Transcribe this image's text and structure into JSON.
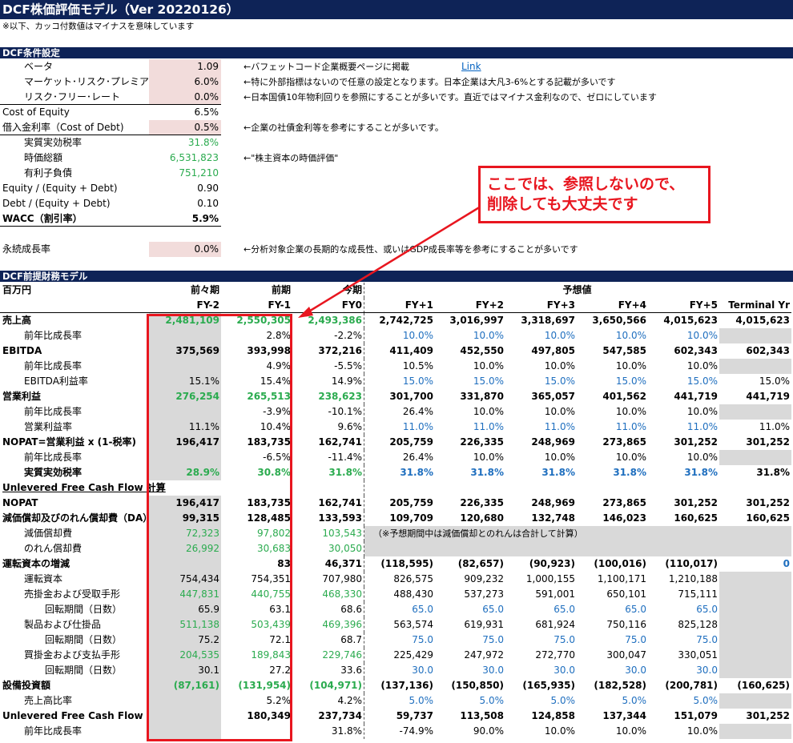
{
  "title": "DCF株価評価モデル（Ver 20220126）",
  "note": "※以下、カッコ付数値はマイナスを意味しています",
  "conditions": {
    "header": "DCF条件設定",
    "link_label": "Link",
    "rows": [
      {
        "label": "ベータ",
        "value": "1.09",
        "note": "←バフェットコード企業概要ページに掲載"
      },
      {
        "label": "マーケット･リスク･プレミアム",
        "value": "6.0%",
        "note": "←特に外部指標はないので任意の設定となります。日本企業は大凡3-6%とする記載が多いです"
      },
      {
        "label": "リスク･フリー･レート",
        "value": "0.0%",
        "note": "←日本国債10年物利回りを参照にすることが多いです。直近ではマイナス金利なので、ゼロにしています"
      },
      {
        "label": "Cost of Equity",
        "value": "6.5%",
        "note": ""
      },
      {
        "label": "借入金利率（Cost of Debt)",
        "value": "0.5%",
        "note": "←企業の社債金利等を参考にすることが多いです。"
      },
      {
        "label": "実質実効税率",
        "value": "31.8%",
        "note": ""
      },
      {
        "label": "時価総額",
        "value": "6,531,823",
        "note": "←\"株主資本の時価評価\""
      },
      {
        "label": "有利子負債",
        "value": "751,210",
        "note": ""
      },
      {
        "label": "Equity / (Equity + Debt)",
        "value": "0.90",
        "note": ""
      },
      {
        "label": "Debt / (Equity + Debt)",
        "value": "0.10",
        "note": ""
      },
      {
        "label": "WACC（割引率）",
        "value": "5.9%",
        "note": ""
      },
      {
        "label": "",
        "value": "",
        "note": ""
      },
      {
        "label": "永続成長率",
        "value": "0.0%",
        "note": "←分析対象企業の長期的な成長性、或いはGDP成長率等を参考にすることが多いです"
      }
    ]
  },
  "callout": "ここでは、参照しないので、\n削除しても大丈夫です",
  "financials": {
    "header": "DCF前提財務モデル",
    "unit": "百万円",
    "period_labels": [
      "前々期",
      "前期",
      "今期"
    ],
    "forecast_label": "予想値",
    "columns": [
      "FY-2",
      "FY-1",
      "FY0",
      "FY+1",
      "FY+2",
      "FY+3",
      "FY+4",
      "FY+5",
      "Terminal Yr"
    ],
    "rows": [
      {
        "label": "売上高",
        "values": [
          "2,481,109",
          "2,550,305",
          "2,493,386",
          "2,742,725",
          "3,016,997",
          "3,318,697",
          "3,650,566",
          "4,015,623",
          "4,015,623"
        ]
      },
      {
        "label": "前年比成長率",
        "values": [
          "",
          "2.8%",
          "-2.2%",
          "10.0%",
          "10.0%",
          "10.0%",
          "10.0%",
          "10.0%",
          ""
        ]
      },
      {
        "label": "EBITDA",
        "values": [
          "375,569",
          "393,998",
          "372,216",
          "411,409",
          "452,550",
          "497,805",
          "547,585",
          "602,343",
          "602,343"
        ]
      },
      {
        "label": "前年比成長率",
        "values": [
          "",
          "4.9%",
          "-5.5%",
          "10.5%",
          "10.0%",
          "10.0%",
          "10.0%",
          "10.0%",
          ""
        ]
      },
      {
        "label": "EBITDA利益率",
        "values": [
          "15.1%",
          "15.4%",
          "14.9%",
          "15.0%",
          "15.0%",
          "15.0%",
          "15.0%",
          "15.0%",
          "15.0%"
        ]
      },
      {
        "label": "営業利益",
        "values": [
          "276,254",
          "265,513",
          "238,623",
          "301,700",
          "331,870",
          "365,057",
          "401,562",
          "441,719",
          "441,719"
        ]
      },
      {
        "label": "前年比成長率",
        "values": [
          "",
          "-3.9%",
          "-10.1%",
          "26.4%",
          "10.0%",
          "10.0%",
          "10.0%",
          "10.0%",
          ""
        ]
      },
      {
        "label": "営業利益率",
        "values": [
          "11.1%",
          "10.4%",
          "9.6%",
          "11.0%",
          "11.0%",
          "11.0%",
          "11.0%",
          "11.0%",
          "11.0%"
        ]
      },
      {
        "label": "NOPAT=営業利益 x (1-税率)",
        "values": [
          "196,417",
          "183,735",
          "162,741",
          "205,759",
          "226,335",
          "248,969",
          "273,865",
          "301,252",
          "301,252"
        ]
      },
      {
        "label": "前年比成長率",
        "values": [
          "",
          "-6.5%",
          "-11.4%",
          "26.4%",
          "10.0%",
          "10.0%",
          "10.0%",
          "10.0%",
          ""
        ]
      },
      {
        "label": "実質実効税率",
        "values": [
          "28.9%",
          "30.8%",
          "31.8%",
          "31.8%",
          "31.8%",
          "31.8%",
          "31.8%",
          "31.8%",
          "31.8%"
        ]
      },
      {
        "label": "Unlevered Free Cash Flow 計算",
        "values": [
          "",
          "",
          "",
          "",
          "",
          "",
          "",
          "",
          ""
        ]
      },
      {
        "label": "NOPAT",
        "values": [
          "196,417",
          "183,735",
          "162,741",
          "205,759",
          "226,335",
          "248,969",
          "273,865",
          "301,252",
          "301,252"
        ]
      },
      {
        "label": "減価償却及びのれん償却費（DA）",
        "values": [
          "99,315",
          "128,485",
          "133,593",
          "109,709",
          "120,680",
          "132,748",
          "146,023",
          "160,625",
          "160,625"
        ]
      },
      {
        "label": "減価償却費",
        "values": [
          "72,323",
          "97,802",
          "103,543",
          "",
          "",
          "",
          "",
          "",
          ""
        ]
      },
      {
        "label": "のれん償却費",
        "values": [
          "26,992",
          "30,683",
          "30,050",
          "",
          "",
          "",
          "",
          "",
          ""
        ]
      },
      {
        "label": "運転資本の増減",
        "values": [
          "",
          "83",
          "46,371",
          "(118,595)",
          "(82,657)",
          "(90,923)",
          "(100,016)",
          "(110,017)",
          "0"
        ]
      },
      {
        "label": "運転資本",
        "values": [
          "754,434",
          "754,351",
          "707,980",
          "826,575",
          "909,232",
          "1,000,155",
          "1,100,171",
          "1,210,188",
          ""
        ]
      },
      {
        "label": "売掛金および受取手形",
        "values": [
          "447,831",
          "440,755",
          "468,330",
          "488,430",
          "537,273",
          "591,001",
          "650,101",
          "715,111",
          ""
        ]
      },
      {
        "label": "回転期間（日数）",
        "values": [
          "65.9",
          "63.1",
          "68.6",
          "65.0",
          "65.0",
          "65.0",
          "65.0",
          "65.0",
          ""
        ]
      },
      {
        "label": "製品および仕掛品",
        "values": [
          "511,138",
          "503,439",
          "469,396",
          "563,574",
          "619,931",
          "681,924",
          "750,116",
          "825,128",
          ""
        ]
      },
      {
        "label": "回転期間（日数）",
        "values": [
          "75.2",
          "72.1",
          "68.7",
          "75.0",
          "75.0",
          "75.0",
          "75.0",
          "75.0",
          ""
        ]
      },
      {
        "label": "買掛金および支払手形",
        "values": [
          "204,535",
          "189,843",
          "229,746",
          "225,429",
          "247,972",
          "272,770",
          "300,047",
          "330,051",
          ""
        ]
      },
      {
        "label": "回転期間（日数）",
        "values": [
          "30.1",
          "27.2",
          "33.6",
          "30.0",
          "30.0",
          "30.0",
          "30.0",
          "30.0",
          ""
        ]
      },
      {
        "label": "設備投資額",
        "values": [
          "(87,161)",
          "(131,954)",
          "(104,971)",
          "(137,136)",
          "(150,850)",
          "(165,935)",
          "(182,528)",
          "(200,781)",
          "(160,625)"
        ]
      },
      {
        "label": "売上高比率",
        "values": [
          "",
          "5.2%",
          "4.2%",
          "5.0%",
          "5.0%",
          "5.0%",
          "5.0%",
          "5.0%",
          ""
        ]
      },
      {
        "label": "Unlevered Free Cash Flow",
        "values": [
          "",
          "180,349",
          "237,734",
          "59,737",
          "113,508",
          "124,858",
          "137,344",
          "151,079",
          "301,252"
        ]
      },
      {
        "label": "前年比成長率",
        "values": [
          "",
          "",
          "31.8%",
          "-74.9%",
          "90.0%",
          "10.0%",
          "10.0%",
          "10.0%",
          ""
        ]
      }
    ],
    "da_note": "（※予想期間中は減価償却とのれんは合計して計算）"
  },
  "colors": {
    "navy": "#0e2357",
    "green": "#2bab4f",
    "blue": "#1f6fbf",
    "red": "#e8161f",
    "pink": "#f2dcdb",
    "gray": "#d9d9d9"
  }
}
